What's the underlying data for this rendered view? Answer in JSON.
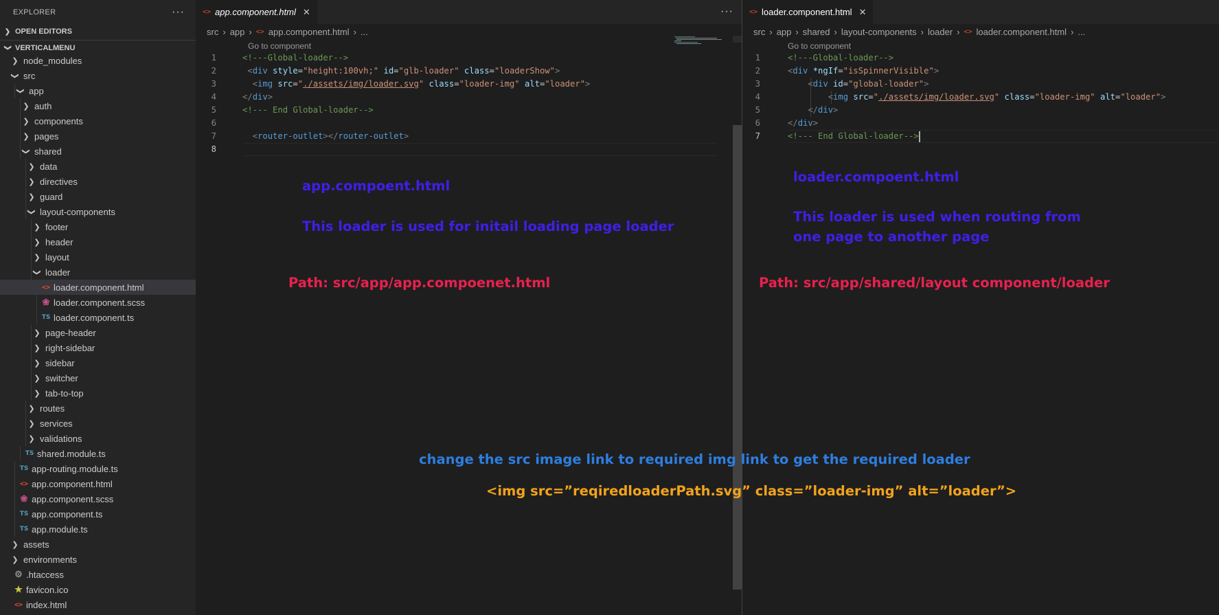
{
  "explorer": {
    "title": "EXPLORER",
    "more": "···",
    "open_editors": "OPEN EDITORS",
    "project": "VERTICALMENU"
  },
  "tree": [
    {
      "label": "node_modules",
      "type": "folder",
      "open": false
    },
    {
      "label": "src",
      "type": "folder",
      "open": true
    },
    {
      "label": "app",
      "type": "folder",
      "open": true
    },
    {
      "label": "auth",
      "type": "folder",
      "open": false
    },
    {
      "label": "components",
      "type": "folder",
      "open": false
    },
    {
      "label": "pages",
      "type": "folder",
      "open": false
    },
    {
      "label": "shared",
      "type": "folder",
      "open": true
    },
    {
      "label": "data",
      "type": "folder",
      "open": false
    },
    {
      "label": "directives",
      "type": "folder",
      "open": false
    },
    {
      "label": "guard",
      "type": "folder",
      "open": false
    },
    {
      "label": "layout-components",
      "type": "folder",
      "open": true
    },
    {
      "label": "footer",
      "type": "folder",
      "open": false
    },
    {
      "label": "header",
      "type": "folder",
      "open": false
    },
    {
      "label": "layout",
      "type": "folder",
      "open": false
    },
    {
      "label": "loader",
      "type": "folder",
      "open": true
    },
    {
      "label": "loader.component.html",
      "type": "html",
      "selected": true
    },
    {
      "label": "loader.component.scss",
      "type": "scss"
    },
    {
      "label": "loader.component.ts",
      "type": "ts"
    },
    {
      "label": "page-header",
      "type": "folder",
      "open": false
    },
    {
      "label": "right-sidebar",
      "type": "folder",
      "open": false
    },
    {
      "label": "sidebar",
      "type": "folder",
      "open": false
    },
    {
      "label": "switcher",
      "type": "folder",
      "open": false
    },
    {
      "label": "tab-to-top",
      "type": "folder",
      "open": false
    },
    {
      "label": "routes",
      "type": "folder",
      "open": false
    },
    {
      "label": "services",
      "type": "folder",
      "open": false
    },
    {
      "label": "validations",
      "type": "folder",
      "open": false
    },
    {
      "label": "shared.module.ts",
      "type": "ts"
    },
    {
      "label": "app-routing.module.ts",
      "type": "ts"
    },
    {
      "label": "app.component.html",
      "type": "html"
    },
    {
      "label": "app.component.scss",
      "type": "scss"
    },
    {
      "label": "app.component.ts",
      "type": "ts"
    },
    {
      "label": "app.module.ts",
      "type": "ts"
    },
    {
      "label": "assets",
      "type": "folder",
      "open": false
    },
    {
      "label": "environments",
      "type": "folder",
      "open": false
    },
    {
      "label": ".htaccess",
      "type": "config"
    },
    {
      "label": "favicon.ico",
      "type": "favicon"
    },
    {
      "label": "index.html",
      "type": "html"
    }
  ],
  "left_editor": {
    "tab": "app.component.html",
    "more": "···",
    "breadcrumbs": [
      "src",
      "app",
      "app.component.html",
      "..."
    ],
    "codelens": "Go to component",
    "line_numbers": [
      "1",
      "2",
      "3",
      "4",
      "5",
      "6",
      "7",
      "8"
    ],
    "lines": [
      [
        {
          "t": "<!---Global-loader-->",
          "c": "com"
        }
      ],
      [
        {
          "t": " <",
          "c": "tag"
        },
        {
          "t": "div",
          "c": "name"
        },
        {
          "t": " style",
          "c": "attr"
        },
        {
          "t": "=",
          "c": "plain"
        },
        {
          "t": "\"height:100vh;\"",
          "c": "str"
        },
        {
          "t": " id",
          "c": "attr"
        },
        {
          "t": "=",
          "c": "plain"
        },
        {
          "t": "\"glb-loader\"",
          "c": "str"
        },
        {
          "t": " class",
          "c": "attr"
        },
        {
          "t": "=",
          "c": "plain"
        },
        {
          "t": "\"loaderShow\"",
          "c": "str"
        },
        {
          "t": ">",
          "c": "tag"
        }
      ],
      [
        {
          "t": "  <",
          "c": "tag"
        },
        {
          "t": "img",
          "c": "name"
        },
        {
          "t": " src",
          "c": "attr"
        },
        {
          "t": "=",
          "c": "plain"
        },
        {
          "t": "\"",
          "c": "str"
        },
        {
          "t": "./assets/img/loader.svg",
          "c": "link"
        },
        {
          "t": "\"",
          "c": "str"
        },
        {
          "t": " class",
          "c": "attr"
        },
        {
          "t": "=",
          "c": "plain"
        },
        {
          "t": "\"loader-img\"",
          "c": "str"
        },
        {
          "t": " alt",
          "c": "attr"
        },
        {
          "t": "=",
          "c": "plain"
        },
        {
          "t": "\"loader\"",
          "c": "str"
        },
        {
          "t": ">",
          "c": "tag"
        }
      ],
      [
        {
          "t": "</",
          "c": "tag"
        },
        {
          "t": "div",
          "c": "name"
        },
        {
          "t": ">",
          "c": "tag"
        }
      ],
      [
        {
          "t": "<!--- End Global-loader-->",
          "c": "com"
        }
      ],
      [
        {
          "t": "",
          "c": "plain"
        }
      ],
      [
        {
          "t": "  <",
          "c": "tag"
        },
        {
          "t": "router-outlet",
          "c": "name"
        },
        {
          "t": "></",
          "c": "tag"
        },
        {
          "t": "router-outlet",
          "c": "name"
        },
        {
          "t": ">",
          "c": "tag"
        }
      ],
      [
        {
          "t": "",
          "c": "plain"
        }
      ]
    ]
  },
  "right_editor": {
    "tab": "loader.component.html",
    "breadcrumbs": [
      "src",
      "app",
      "shared",
      "layout-components",
      "loader",
      "loader.component.html",
      "..."
    ],
    "codelens": "Go to component",
    "line_numbers": [
      "1",
      "2",
      "3",
      "4",
      "5",
      "6",
      "7"
    ],
    "lines": [
      [
        {
          "t": "<!---Global-loader-->",
          "c": "com"
        }
      ],
      [
        {
          "t": "<",
          "c": "tag"
        },
        {
          "t": "div",
          "c": "name"
        },
        {
          "t": " *ngIf",
          "c": "attr"
        },
        {
          "t": "=",
          "c": "plain"
        },
        {
          "t": "\"isSpinnerVisible\"",
          "c": "str"
        },
        {
          "t": ">",
          "c": "tag"
        }
      ],
      [
        {
          "t": "    <",
          "c": "tag"
        },
        {
          "t": "div",
          "c": "name"
        },
        {
          "t": " id",
          "c": "attr"
        },
        {
          "t": "=",
          "c": "plain"
        },
        {
          "t": "\"global-loader\"",
          "c": "str"
        },
        {
          "t": ">",
          "c": "tag"
        }
      ],
      [
        {
          "t": "        <",
          "c": "tag"
        },
        {
          "t": "img",
          "c": "name"
        },
        {
          "t": " src",
          "c": "attr"
        },
        {
          "t": "=",
          "c": "plain"
        },
        {
          "t": "\"",
          "c": "str"
        },
        {
          "t": "./assets/img/loader.svg",
          "c": "link"
        },
        {
          "t": "\"",
          "c": "str"
        },
        {
          "t": " class",
          "c": "attr"
        },
        {
          "t": "=",
          "c": "plain"
        },
        {
          "t": "\"loader-img\"",
          "c": "str"
        },
        {
          "t": " alt",
          "c": "attr"
        },
        {
          "t": "=",
          "c": "plain"
        },
        {
          "t": "\"loader\"",
          "c": "str"
        },
        {
          "t": ">",
          "c": "tag"
        }
      ],
      [
        {
          "t": "    </",
          "c": "tag"
        },
        {
          "t": "div",
          "c": "name"
        },
        {
          "t": ">",
          "c": "tag"
        }
      ],
      [
        {
          "t": "</",
          "c": "tag"
        },
        {
          "t": "div",
          "c": "name"
        },
        {
          "t": ">",
          "c": "tag"
        }
      ],
      [
        {
          "t": "<!--- End Global-loader-->",
          "c": "com"
        }
      ]
    ]
  },
  "annotations": {
    "left_title": "app.compoent.html",
    "left_desc": "This loader is used for initail loading page loader",
    "left_path": "Path: src/app/app.compoenet.html",
    "right_title": "loader.compoent.html",
    "right_desc_1": "This loader is used when routing from",
    "right_desc_2": "one page to another page",
    "right_path": "Path: src/app/shared/layout component/loader",
    "instruction": "change the src image link to required img link to get the required loader",
    "example": "<img src=”reqiredloaderPath.svg” class=”loader-img” alt=”loader”>"
  },
  "colors": {
    "annotation_purple": "#3f1fe8",
    "annotation_red": "#e8214e",
    "annotation_blue": "#2d7ee0",
    "annotation_orange": "#f2a31c"
  }
}
